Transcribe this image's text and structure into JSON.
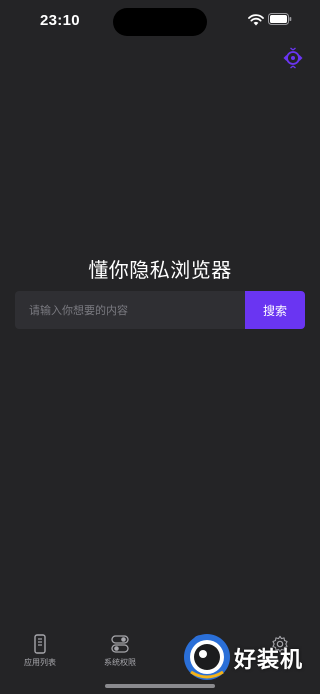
{
  "status_bar": {
    "time": "23:10"
  },
  "header": {
    "swap_icon": "swap-circle-icon",
    "accent_color": "#6a35f2"
  },
  "browser": {
    "title": "懂你隐私浏览器",
    "search": {
      "placeholder": "请输入你想要的内容",
      "value": "",
      "button_label": "搜索"
    }
  },
  "tab_bar": {
    "tabs": [
      {
        "label": "应用列表",
        "icon": "phone-list-icon"
      },
      {
        "label": "系统权限",
        "icon": "toggle-icon"
      },
      {
        "label": "",
        "icon": "browser-globe-icon",
        "active": true
      },
      {
        "label": "",
        "icon": "settings-gear-icon"
      }
    ]
  },
  "watermark": {
    "text": "好装机"
  }
}
